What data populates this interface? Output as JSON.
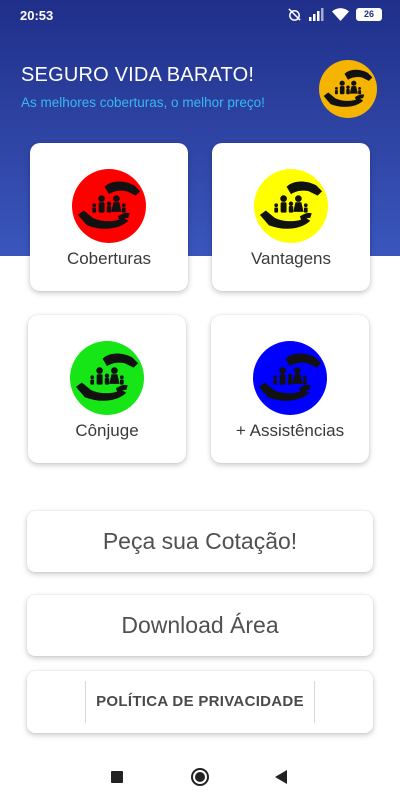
{
  "status_bar": {
    "time": "20:53",
    "battery": "26",
    "icons": [
      "alarm-off-icon",
      "signal-icon",
      "wifi-icon",
      "battery-icon"
    ]
  },
  "header": {
    "title": "SEGURO VIDA BARATO!",
    "subtitle": "As melhores coberturas, o melhor preço!",
    "logo": {
      "icon": "family-hands-icon",
      "color": "#f5b400"
    }
  },
  "cards": [
    {
      "label": "Coberturas",
      "icon": "family-hands-icon",
      "color": "#ff0000"
    },
    {
      "label": "Vantagens",
      "icon": "family-hands-icon",
      "color": "#ffff00"
    },
    {
      "label": "Cônjuge",
      "icon": "family-hands-icon",
      "color": "#16e616"
    },
    {
      "label": "+ Assistências",
      "icon": "family-hands-icon",
      "color": "#0000ff"
    }
  ],
  "buttons": {
    "quote": "Peça sua Cotação!",
    "download": "Download Área",
    "privacy": "POLÍTICA DE PRIVACIDADE"
  },
  "colors": {
    "header_gradient_top": "#1f2f8a",
    "header_gradient_bottom": "#3a56bd",
    "subtitle": "#39b8ef"
  },
  "nav": {
    "icons": [
      "recent-apps-icon",
      "home-icon",
      "back-icon"
    ]
  }
}
